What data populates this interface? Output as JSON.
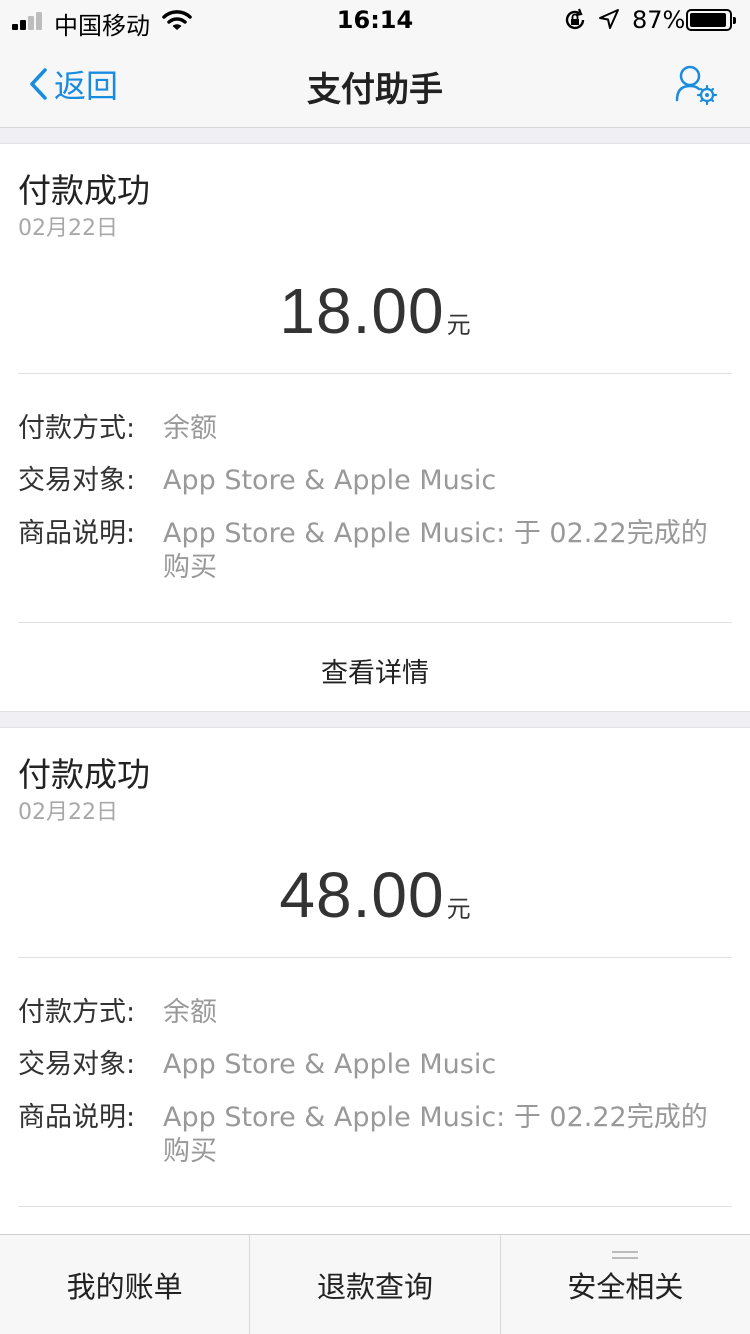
{
  "status_bar": {
    "carrier": "中国移动",
    "time": "16:14",
    "battery_percent": "87%"
  },
  "nav": {
    "back_label": "返回",
    "title": "支付助手"
  },
  "cards": [
    {
      "title": "付款成功",
      "date": "02月22日",
      "amount": "18.00",
      "unit": "元",
      "payment_method_label": "付款方式:",
      "payment_method_value": "余额",
      "counterparty_label": "交易对象:",
      "counterparty_value": "App Store & Apple Music",
      "description_label": "商品说明:",
      "description_value": "App Store & Apple Music: 于 02.22完成的购买",
      "detail_label": "查看详情"
    },
    {
      "title": "付款成功",
      "date": "02月22日",
      "amount": "48.00",
      "unit": "元",
      "payment_method_label": "付款方式:",
      "payment_method_value": "余额",
      "counterparty_label": "交易对象:",
      "counterparty_value": "App Store & Apple Music",
      "description_label": "商品说明:",
      "description_value": "App Store & Apple Music: 于 02.22完成的购买"
    }
  ],
  "tabbar": {
    "tabs": [
      "我的账单",
      "退款查询",
      "安全相关"
    ]
  },
  "colors": {
    "accent": "#1a8ce0",
    "background": "#efeff4",
    "muted_text": "#999999"
  }
}
